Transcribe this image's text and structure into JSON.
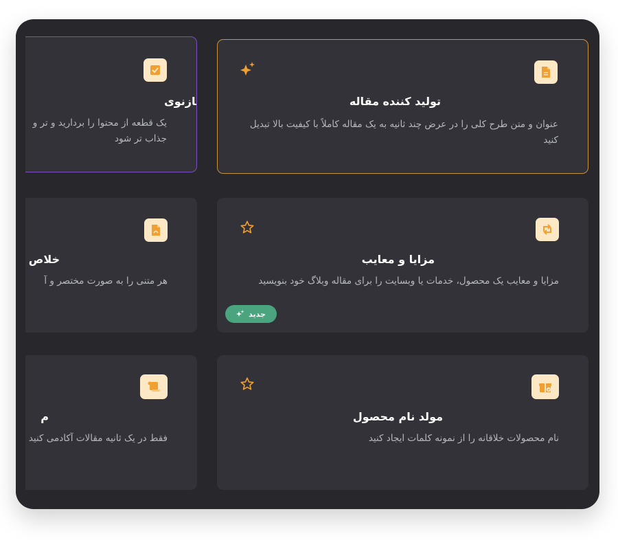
{
  "colors": {
    "panel_bg": "#27272c",
    "card_bg": "#323238",
    "selected_border_orange": "#c8943a",
    "selected_border_purple": "#7c4fc2",
    "icon_bg": "#fde8c6",
    "icon_fg": "#f0a032",
    "badge_bg": "#4aa57f"
  },
  "cards": [
    {
      "title": "تولید کننده مقاله",
      "description": "عنوان و متن طرح کلی را در عرض چند ثانیه به یک مقاله کاملاً با کیفیت بالا تبدیل کنید",
      "icon": "document-icon",
      "favorite_icon": "sparkle-icon",
      "selected": true
    },
    {
      "title": "بازنوی",
      "description": "یک قطعه از محتوا را بردارید و تر و جذاب تر شود",
      "icon": "checklist-icon",
      "selected": true
    },
    {
      "title": "مزایا و معایب",
      "description": "مزایا و معایب یک محصول، خدمات یا وبسایت را برای مقاله وبلاگ خود بنویسید",
      "icon": "swap-arrows-icon",
      "favorite_icon": "star-outline-icon",
      "badge": "جدید"
    },
    {
      "title": "خلاص",
      "description": "هر متنی را به صورت مختصر و آ",
      "icon": "pdf-file-icon"
    },
    {
      "title": "مولد نام محصول",
      "description": "نام محصولات خلاقانه را از نمونه کلمات ایجاد کنید",
      "icon": "gift-box-icon",
      "favorite_icon": "star-outline-icon"
    },
    {
      "title": "م",
      "description": "فقط در یک ثانیه مقالات آکادمی کنید",
      "icon": "scroll-icon"
    }
  ]
}
